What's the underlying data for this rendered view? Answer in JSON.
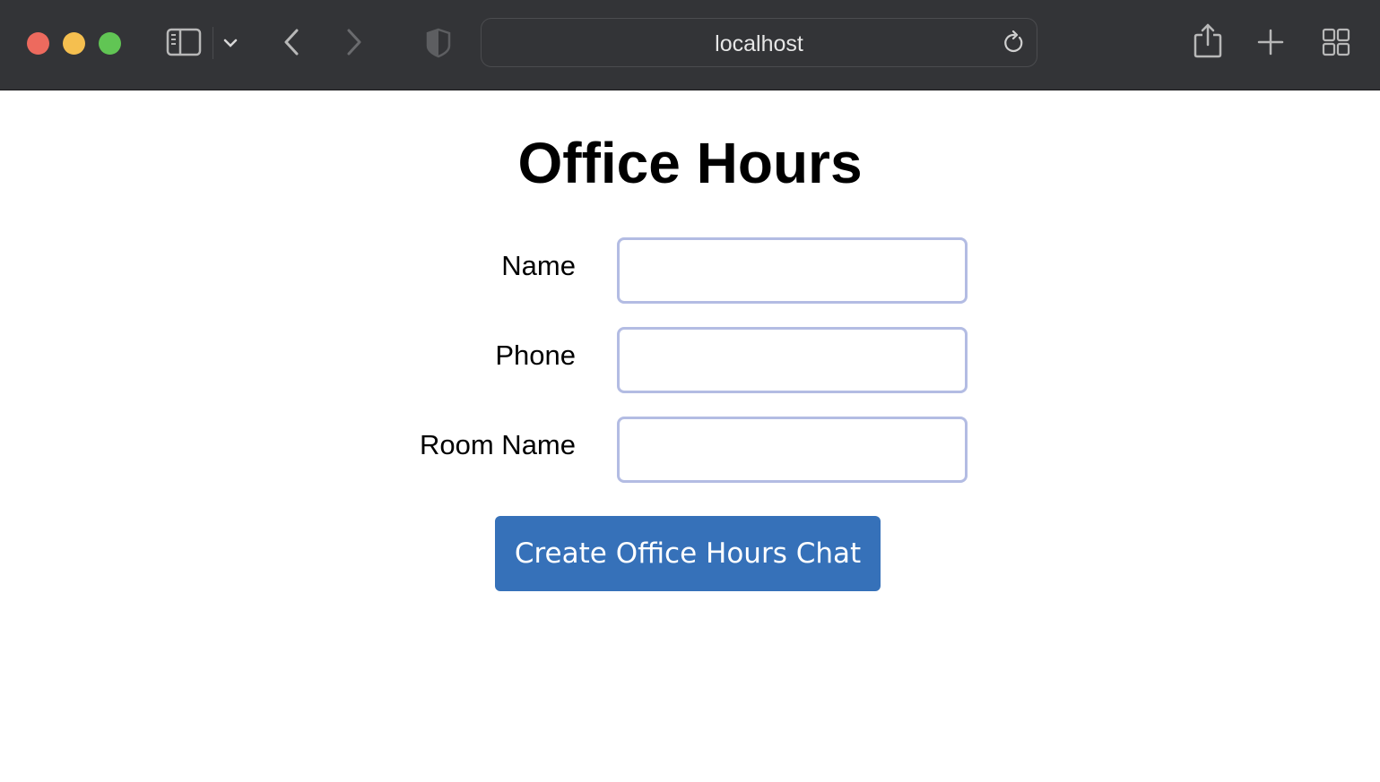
{
  "browser": {
    "url": "localhost",
    "icons": {
      "close": "close-window-icon",
      "minimize": "minimize-window-icon",
      "maximize": "maximize-window-icon",
      "sidebar": "sidebar-icon",
      "sidebar_menu": "chevron-down-icon",
      "back": "back-arrow-icon",
      "forward": "forward-arrow-icon",
      "privacy": "shield-icon",
      "reload": "reload-icon",
      "share": "share-icon",
      "new_tab": "plus-icon",
      "tab_overview": "grid-icon"
    }
  },
  "page": {
    "title": "Office Hours",
    "form": {
      "fields": [
        {
          "label": "Name",
          "value": "",
          "placeholder": ""
        },
        {
          "label": "Phone",
          "value": "",
          "placeholder": ""
        },
        {
          "label": "Room Name",
          "value": "",
          "placeholder": ""
        }
      ],
      "submit_label": "Create Office Hours Chat"
    }
  },
  "colors": {
    "toolbar_bg": "#333437",
    "input_border": "#b3bce3",
    "button_bg": "#3671b9",
    "button_text": "#ffffff"
  }
}
